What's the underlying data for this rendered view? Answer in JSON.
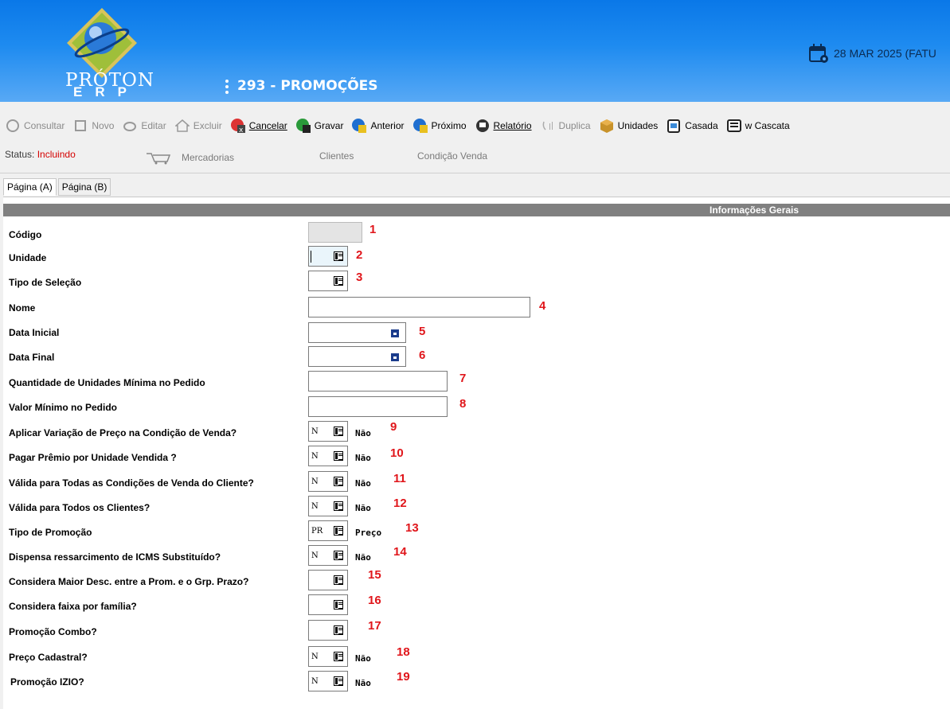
{
  "header": {
    "logo_text": "PRÓTON",
    "logo_sub": "ERP",
    "screen_title": "293 - PROMOÇÕES",
    "date_text": "28 MAR 2025 (FATU"
  },
  "toolbar": {
    "consultar": "Consultar",
    "novo": "Novo",
    "editar": "Editar",
    "excluir": "Excluir",
    "cancelar": "Cancelar",
    "gravar": "Gravar",
    "anterior": "Anterior",
    "proximo": "Próximo",
    "relatorio": "Relatório",
    "duplica": "Duplica",
    "unidades": "Unidades",
    "casada": "Casada",
    "cascata": "w Cascata"
  },
  "status": {
    "label": "Status:",
    "value": "Incluindo",
    "mercadorias": "Mercadorias",
    "clientes": "Clientes",
    "condicao_venda": "Condição Venda"
  },
  "tabs": [
    "Página (A)",
    "Página (B)"
  ],
  "section_title": "Informações Gerais",
  "fields": [
    {
      "label": "Código",
      "value": "",
      "desc": "",
      "num": "1"
    },
    {
      "label": "Unidade",
      "value": "",
      "desc": "",
      "num": "2"
    },
    {
      "label": "Tipo de Seleção",
      "value": "",
      "desc": "",
      "num": "3"
    },
    {
      "label": "Nome",
      "value": "",
      "desc": "",
      "num": "4"
    },
    {
      "label": "Data Inicial",
      "value": "",
      "desc": "",
      "num": "5"
    },
    {
      "label": "Data Final",
      "value": "",
      "desc": "",
      "num": "6"
    },
    {
      "label": "Quantidade de Unidades Mínima no Pedido",
      "value": "",
      "desc": "",
      "num": "7"
    },
    {
      "label": "Valor Mínimo no Pedido",
      "value": "",
      "desc": "",
      "num": "8"
    },
    {
      "label": "Aplicar Variação de Preço na Condição de Venda?",
      "value": "N",
      "desc": "Não",
      "num": "9"
    },
    {
      "label": "Pagar Prêmio por Unidade Vendida ?",
      "value": "N",
      "desc": "Não",
      "num": "10"
    },
    {
      "label": "Válida para Todas as Condições de Venda do Cliente?",
      "value": "N",
      "desc": "Não",
      "num": "11"
    },
    {
      "label": "Válida para Todos os Clientes?",
      "value": "N",
      "desc": "Não",
      "num": "12"
    },
    {
      "label": "Tipo de Promoção",
      "value": "PR",
      "desc": "Preço",
      "num": "13"
    },
    {
      "label": "Dispensa ressarcimento de ICMS Substituído?",
      "value": "N",
      "desc": "Não",
      "num": "14"
    },
    {
      "label": "Considera Maior Desc. entre a Prom. e o Grp. Prazo?",
      "value": "",
      "desc": "",
      "num": "15"
    },
    {
      "label": "Considera faixa por família?",
      "value": "",
      "desc": "",
      "num": "16"
    },
    {
      "label": "Promoção Combo?",
      "value": "",
      "desc": "",
      "num": "17"
    },
    {
      "label": "Preço Cadastral?",
      "value": "N",
      "desc": "Não",
      "num": "18"
    },
    {
      "label": "Promoção IZIO?",
      "value": "N",
      "desc": "Não",
      "num": "19"
    }
  ]
}
